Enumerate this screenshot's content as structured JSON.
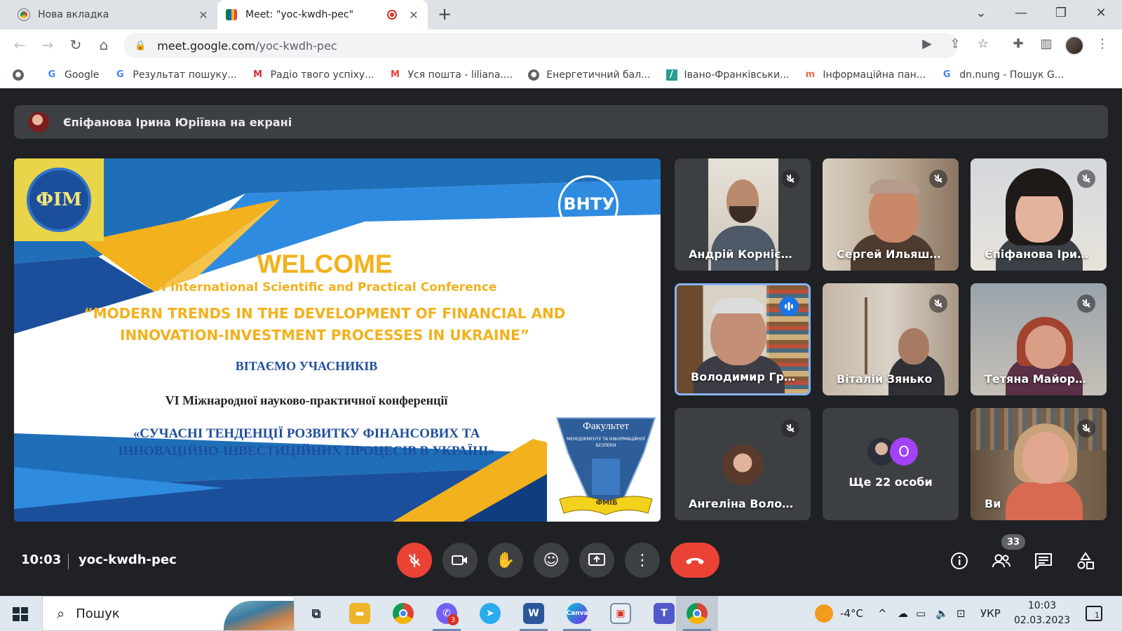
{
  "browser": {
    "tabs": [
      {
        "title": "Нова вкладка",
        "active": false
      },
      {
        "title": "Meet: \"yoc-kwdh-pec\"",
        "active": true
      }
    ],
    "address": {
      "host": "meet.google.com",
      "path": "/yoc-kwdh-pec"
    },
    "bookmarks": [
      {
        "label": "Google",
        "icon": "google-icon"
      },
      {
        "label": "Результат пошуку...",
        "icon": "google-icon"
      },
      {
        "label": "Радіо твого успіху...",
        "icon": "radio-icon"
      },
      {
        "label": "Уся пошта - liliana....",
        "icon": "gmail-icon"
      },
      {
        "label": "Енергетичний бал...",
        "icon": "globe-icon"
      },
      {
        "label": "Івано-Франківськи...",
        "icon": "site-icon"
      },
      {
        "label": "Інформаційна пан...",
        "icon": "site-icon"
      },
      {
        "label": "dn.nung - Пошук G...",
        "icon": "google-icon"
      }
    ]
  },
  "meet": {
    "presenting_banner": "Єпіфанова Ірина Юріївна на екрані",
    "slide": {
      "logo_left": "ФІМ",
      "logo_right": "ВНТУ",
      "welcome": "WELCOME",
      "conference_en": "VI International Scientific and Practical Conference",
      "title_en_line1": "“MODERN TRENDS IN THE DEVELOPMENT OF FINANCIAL AND",
      "title_en_line2": "INNOVATION-INVESTMENT PROCESSES IN UKRAINE”",
      "greeting_ua": "ВІТАЄМО УЧАСНИКІВ",
      "conference_ua": "VI Міжнародної науково-практичної конференції",
      "title_ua_line1": "«СУЧАСНІ ТЕНДЕНЦІЇ РОЗВИТКУ ФІНАНСОВИХ ТА",
      "title_ua_line2": "ІННОВАЦІЙНО-ІНВЕСТИЦІЙНИХ ПРОЦЕСІВ В УКРАЇНІ»",
      "faculty_label": "Факультет",
      "faculty_sub": "МЕНЕДЖМЕНТУ ТА ІНФОРМАЦІЙНОЇ БЕЗПЕКИ",
      "faculty_ribbon": "ФМІБ"
    },
    "participants": [
      {
        "name": "Андрій Корнієнко",
        "muted": true
      },
      {
        "name": "Сергей Ильяше...",
        "muted": true
      },
      {
        "name": "Єпіфанова Ірин...",
        "muted": true
      },
      {
        "name": "Володимир Гра...",
        "muted": false,
        "speaking": true
      },
      {
        "name": "Віталій Зянько",
        "muted": true
      },
      {
        "name": "Тетяна Майорова",
        "muted": true
      },
      {
        "name": "Ангеліна Волод...",
        "muted": true
      },
      {
        "name": "Ще 22 особи",
        "extra_avatar_letter": "O"
      },
      {
        "name": "Ви",
        "muted": true
      }
    ],
    "clock": "10:03",
    "meeting_code": "yoc-kwdh-pec",
    "participant_count": "33",
    "colors": {
      "hangup": "#ea4335",
      "speaking_border": "#8ab4f8",
      "tile_bg": "#3c4043"
    }
  },
  "taskbar": {
    "search_placeholder": "Пошук",
    "viber_badge": "3",
    "temperature": "-4°C",
    "language": "УКР",
    "time": "10:03",
    "date": "02.03.2023",
    "notifications": "1"
  }
}
